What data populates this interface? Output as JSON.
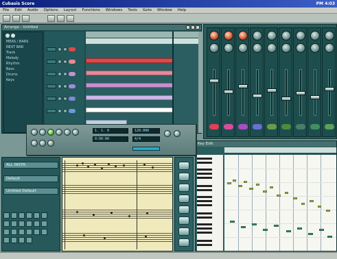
{
  "window": {
    "title": "Cubasis Score",
    "title_right": "PM 4:03"
  },
  "menu": [
    "File",
    "Edit",
    "Audio",
    "Options",
    "Layout",
    "Functions",
    "Windows",
    "Tools",
    "Goto",
    "Window",
    "Help"
  ],
  "arrange": {
    "title": "Arrange - Untitled",
    "track_header_lines": [
      "MEAS / BARS",
      "NEXT BAR",
      "Track",
      "Melody",
      "Rhythm",
      "Bass",
      "Drums",
      "Keys"
    ],
    "lane_colors": [
      "#e14848",
      "#e58a9b",
      "#c88fd0",
      "#cdb6e8",
      "#ffffff",
      "#bcd0e8"
    ]
  },
  "transport": {
    "lcd1": "1. 1. 0",
    "lcd2": "0:00:00",
    "lcd3": "120.000",
    "lcd4": "4/4"
  },
  "left_panel": {
    "buttons": [
      "ALL INSTR.",
      "Default",
      "Untitled Default"
    ]
  },
  "roll": {
    "title": "Key Edit"
  },
  "mixer": {
    "button_colors": [
      "#e0405a",
      "#d94c9c",
      "#a94dc4",
      "#6b6fd2",
      "#6c9b48",
      "#4c8c3a",
      "#4a7d66",
      "#3f8f5f",
      "#5aa05a"
    ]
  },
  "colors": {
    "accent": "#0b1e7a",
    "panel": "#1c4a4c",
    "score_bg": "#efe9bc"
  }
}
